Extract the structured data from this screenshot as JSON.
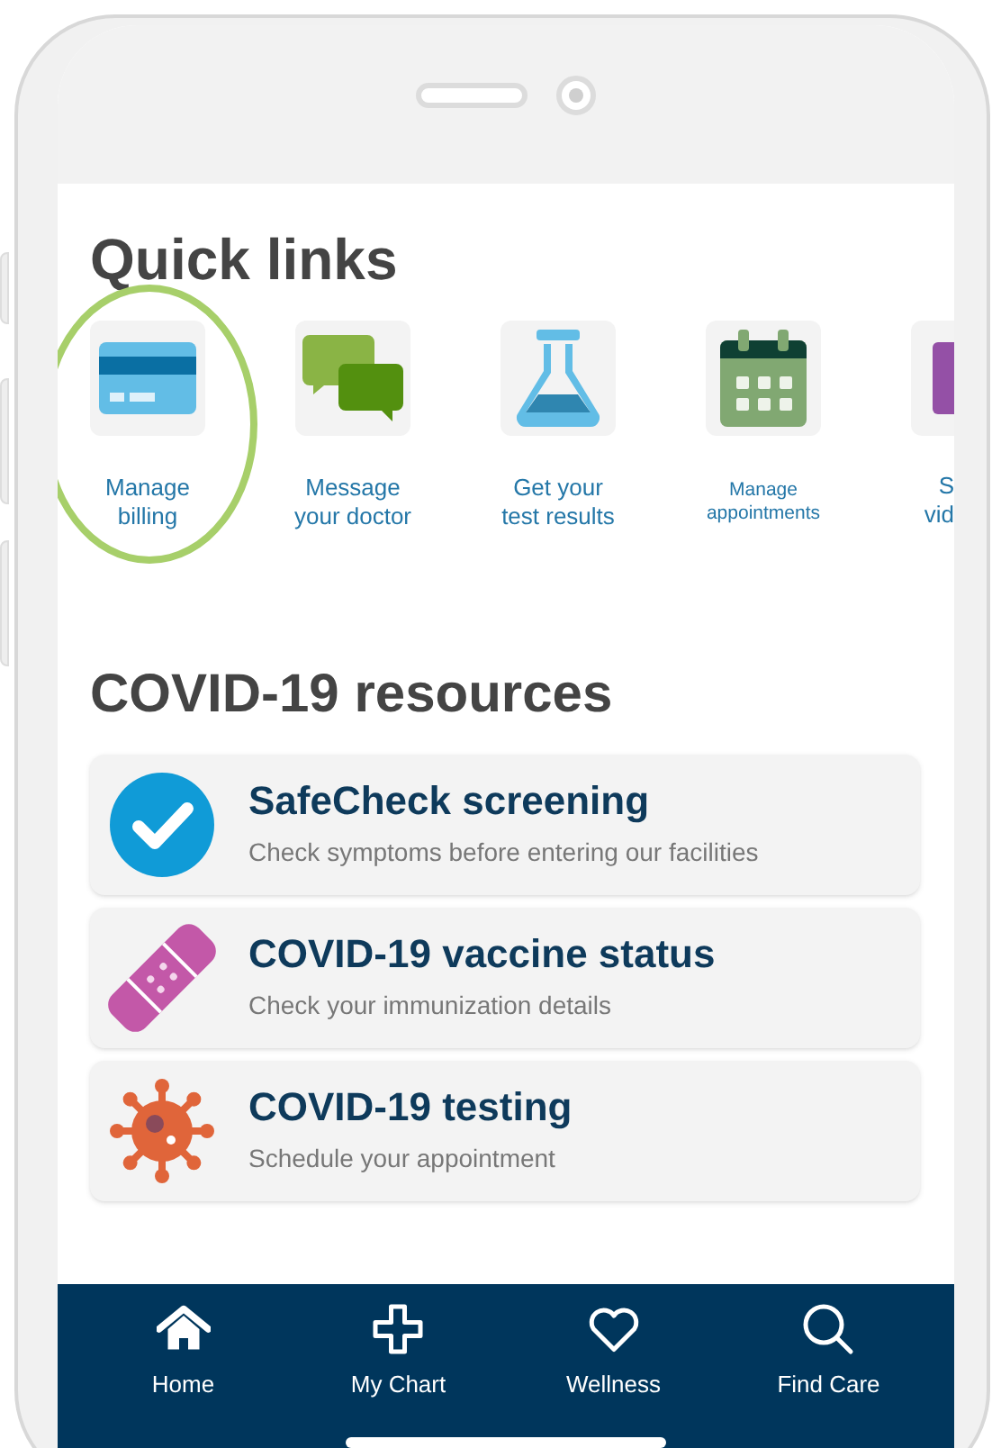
{
  "quick_links": {
    "title": "Quick links",
    "items": [
      {
        "kind": "card",
        "lines": [
          "Manage",
          "billing"
        ],
        "highlighted": true
      },
      {
        "kind": "chat",
        "lines": [
          "Message",
          "your doctor"
        ],
        "highlighted": false
      },
      {
        "kind": "flask",
        "lines": [
          "Get your",
          "test results"
        ],
        "highlighted": false
      },
      {
        "kind": "calendar",
        "lines": [
          "Manage",
          "appointments"
        ],
        "highlighted": false
      },
      {
        "kind": "video",
        "lines": [
          "S",
          "vid"
        ],
        "highlighted": false
      }
    ]
  },
  "covid_resources": {
    "title": "COVID-19 resources",
    "items": [
      {
        "kind": "check",
        "title": "SafeCheck screening",
        "subtitle": "Check symptoms before entering our facilities"
      },
      {
        "kind": "bandage",
        "title": "COVID-19 vaccine status",
        "subtitle": "Check your immunization details"
      },
      {
        "kind": "virus",
        "title": "COVID-19 testing",
        "subtitle": "Schedule your appointment"
      }
    ]
  },
  "tab_bar": [
    {
      "kind": "home",
      "label": "Home"
    },
    {
      "kind": "plus",
      "label": "My Chart"
    },
    {
      "kind": "heart",
      "label": "Wellness"
    },
    {
      "kind": "search",
      "label": "Find Care"
    }
  ]
}
